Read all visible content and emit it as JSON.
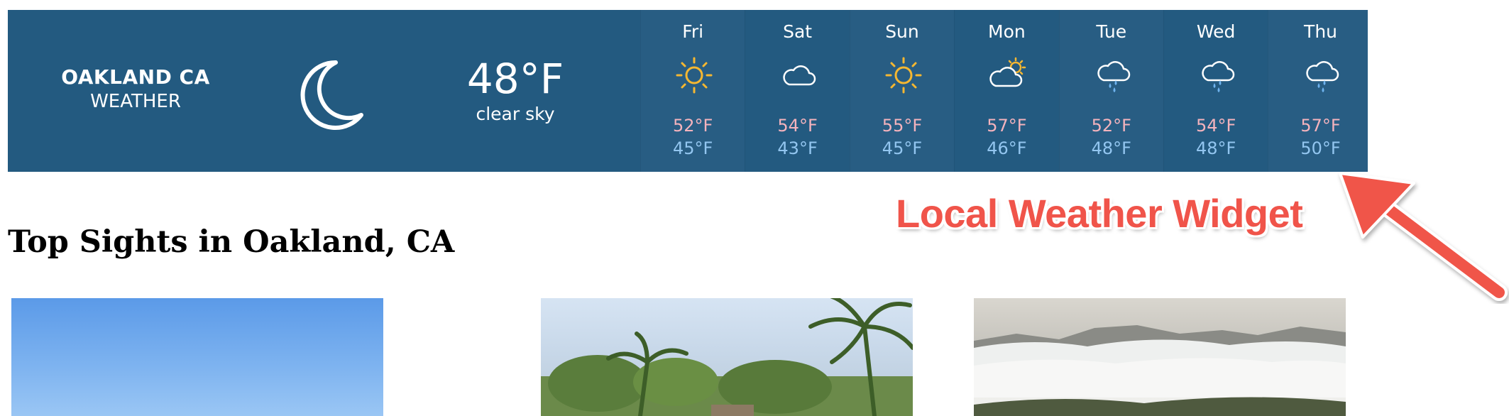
{
  "widget": {
    "city_name": "OAKLAND CA",
    "city_sub": "WEATHER",
    "current_icon": "moon-icon",
    "current_temp": "48°F",
    "current_desc": "clear sky",
    "forecast": [
      {
        "day": "Fri",
        "icon": "sun-icon",
        "high": "52°F",
        "low": "45°F"
      },
      {
        "day": "Sat",
        "icon": "cloud-icon",
        "high": "54°F",
        "low": "43°F"
      },
      {
        "day": "Sun",
        "icon": "sun-icon",
        "high": "55°F",
        "low": "45°F"
      },
      {
        "day": "Mon",
        "icon": "partly-cloudy-icon",
        "high": "57°F",
        "low": "46°F"
      },
      {
        "day": "Tue",
        "icon": "rain-cloud-icon",
        "high": "52°F",
        "low": "48°F"
      },
      {
        "day": "Wed",
        "icon": "rain-cloud-icon",
        "high": "54°F",
        "low": "48°F"
      },
      {
        "day": "Thu",
        "icon": "rain-cloud-icon",
        "high": "57°F",
        "low": "50°F"
      }
    ],
    "colors": {
      "background": "#235a80",
      "high": "#f4b3bd",
      "low": "#93c6f0",
      "sun": "#f5b731"
    }
  },
  "annotation": {
    "label": "Local Weather Widget",
    "color": "#f0544a"
  },
  "section": {
    "heading": "Top Sights in Oakland, CA"
  }
}
